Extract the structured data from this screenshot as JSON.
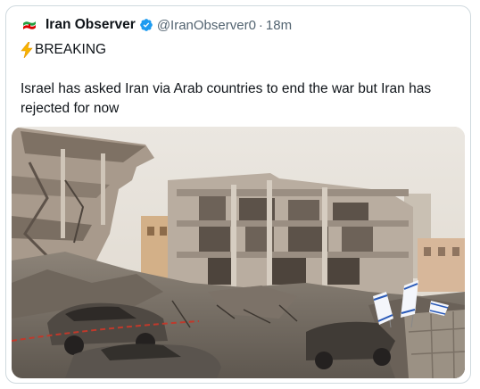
{
  "tweet": {
    "display_name": "Iran Observer",
    "handle": "@IranObserver0",
    "separator": "·",
    "time": "18m",
    "line1": "BREAKING",
    "body": "Israel has asked Iran via Arab countries to end the war but Iran has rejected for now",
    "icons": {
      "avatar": "iran-flag-avatar-icon",
      "verified": "verified-badge-icon",
      "bolt": "lightning-bolt-icon"
    },
    "colors": {
      "verified": "#1d9bf0",
      "handle": "#536471",
      "border": "#cfd9de"
    }
  },
  "media": {
    "type": "photo",
    "subject": "destroyed buildings and burned cars with Israeli flags"
  }
}
